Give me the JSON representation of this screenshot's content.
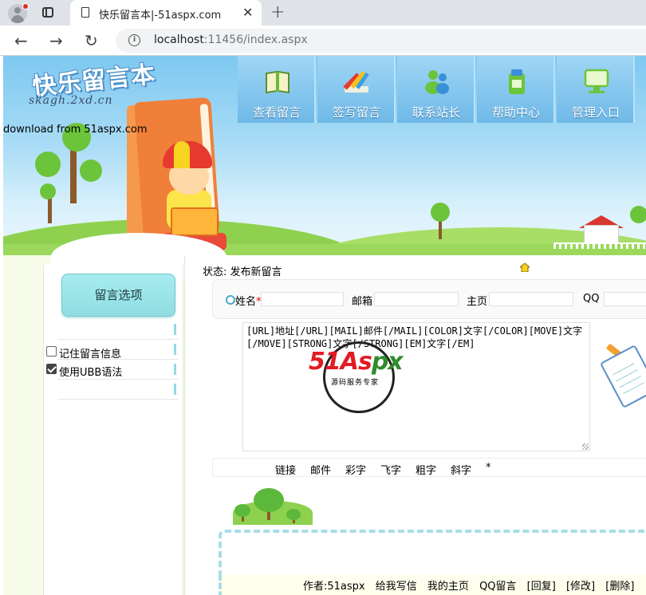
{
  "browser": {
    "tab_title": "快乐留言本|-51aspx.com",
    "url_host": "localhost",
    "url_rest": ":11456/index.aspx"
  },
  "header": {
    "logo_title": "快乐留言本",
    "logo_sub": "skagh.2xd.cn",
    "download_note": "download from 51aspx.com",
    "menu": [
      {
        "label": "查看留言",
        "icon": "book-icon"
      },
      {
        "label": "签写留言",
        "icon": "pencil-icon"
      },
      {
        "label": "联系站长",
        "icon": "contacts-icon"
      },
      {
        "label": "帮助中心",
        "icon": "help-icon"
      },
      {
        "label": "管理入口",
        "icon": "admin-icon"
      }
    ]
  },
  "sidebar": {
    "options_button": "留言选项",
    "remember_label": "记住留言信息",
    "ubb_label": "使用UBB语法",
    "remember_checked": false,
    "ubb_checked": true
  },
  "main": {
    "status": "状态: 发布新留言",
    "fields": {
      "name_label": "姓名",
      "name_required": "*",
      "email_label": "邮箱",
      "homepage_label": "主页",
      "qq_label": "QQ"
    },
    "textarea_value": "[URL]地址[/URL][MAIL]邮件[/MAIL][COLOR]文字[/COLOR][MOVE]文字[/MOVE][STRONG]文字[/STRONG][EM]文字[/EM]",
    "watermark": {
      "brand_red": "51",
      "brand_mid": "As",
      "brand_green": "px",
      "sub": "源码服务专家"
    },
    "ubb_buttons": [
      "链接",
      "邮件",
      "彩字",
      "飞字",
      "粗字",
      "斜字"
    ],
    "ubb_required": "*",
    "entry": {
      "author": "作者:51aspx",
      "write_me": "给我写信",
      "my_home": "我的主页",
      "qq": "QQ留言",
      "reply": "[回复]",
      "edit": "[修改]",
      "delete": "[删除]"
    }
  },
  "colors": {
    "sky": "#7ec8f0",
    "menu_top": "#9fd6f5",
    "menu_bottom": "#6fb9e8",
    "options_button": "#a7ecef",
    "dashed_border": "#a8dde8",
    "required": "#e00000"
  }
}
